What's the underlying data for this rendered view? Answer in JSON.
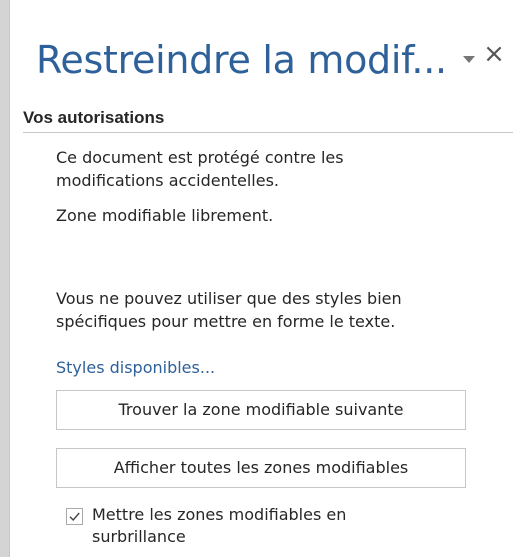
{
  "pane": {
    "title": "Restreindre la modif...",
    "options_icon": "dropdown-arrow-icon",
    "close_glyph": "×",
    "close_icon": "close-icon"
  },
  "permissions": {
    "heading": "Vos autorisations",
    "protection_line1": "Ce document est protégé contre les",
    "protection_line2": "modifications accidentelles.",
    "zone_text": "Zone modifiable librement.",
    "styles_line1": "Vous ne pouvez utiliser que des styles bien",
    "styles_line2": "spécifiques pour mettre en forme le texte.",
    "styles_link": "Styles disponibles...",
    "find_next_button": "Trouver la zone modifiable suivante",
    "show_all_button": "Afficher toutes les zones modifiables",
    "highlight_checkbox": {
      "label": "Mettre les zones modifiables en surbrillance",
      "checked": true
    }
  },
  "colors": {
    "title": "#2e6099",
    "link": "#2e6099",
    "text": "#262626",
    "border": "#c6c6c6"
  }
}
